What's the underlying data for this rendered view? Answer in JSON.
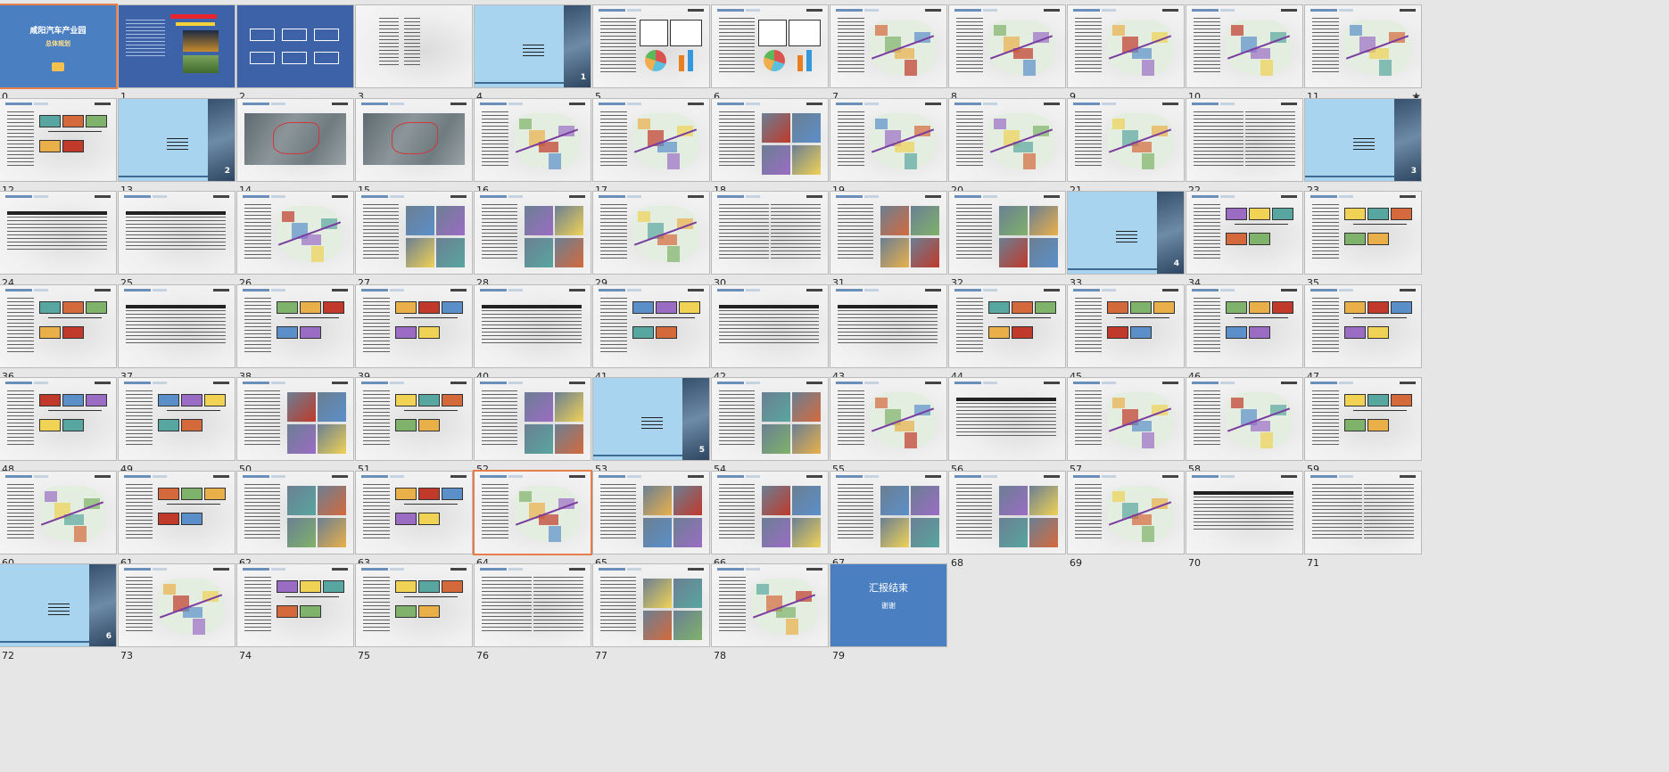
{
  "slides": [
    {
      "num": "0",
      "type": "title",
      "title": "咸阳汽车产业园",
      "subtitle": "总体规划",
      "selected": true
    },
    {
      "num": "1",
      "type": "title-banner",
      "title": ""
    },
    {
      "num": "2",
      "type": "flowchart"
    },
    {
      "num": "3",
      "type": "toc"
    },
    {
      "num": "4",
      "type": "section",
      "label": "1"
    },
    {
      "num": "5",
      "type": "content",
      "variant": "charts"
    },
    {
      "num": "6",
      "type": "content",
      "variant": "charts"
    },
    {
      "num": "7",
      "type": "content",
      "variant": "maps"
    },
    {
      "num": "8",
      "type": "content",
      "variant": "maps"
    },
    {
      "num": "9",
      "type": "content",
      "variant": "maps"
    },
    {
      "num": "10",
      "type": "content",
      "variant": "maps"
    },
    {
      "num": "11",
      "type": "content",
      "variant": "maps",
      "starred": true
    },
    {
      "num": "12",
      "type": "content",
      "variant": "diagram"
    },
    {
      "num": "13",
      "type": "section",
      "label": "2"
    },
    {
      "num": "14",
      "type": "content",
      "variant": "satellite"
    },
    {
      "num": "15",
      "type": "content",
      "variant": "satellite"
    },
    {
      "num": "16",
      "type": "content",
      "variant": "plan"
    },
    {
      "num": "17",
      "type": "content",
      "variant": "plan"
    },
    {
      "num": "18",
      "type": "content",
      "variant": "photos"
    },
    {
      "num": "19",
      "type": "content",
      "variant": "plan"
    },
    {
      "num": "20",
      "type": "content",
      "variant": "plan"
    },
    {
      "num": "21",
      "type": "content",
      "variant": "plan"
    },
    {
      "num": "22",
      "type": "content",
      "variant": "text"
    },
    {
      "num": "23",
      "type": "section",
      "label": "3"
    },
    {
      "num": "24",
      "type": "content",
      "variant": "table"
    },
    {
      "num": "25",
      "type": "content",
      "variant": "table"
    },
    {
      "num": "26",
      "type": "content",
      "variant": "plan"
    },
    {
      "num": "27",
      "type": "content",
      "variant": "photos"
    },
    {
      "num": "28",
      "type": "content",
      "variant": "photos"
    },
    {
      "num": "29",
      "type": "content",
      "variant": "plan"
    },
    {
      "num": "30",
      "type": "content",
      "variant": "text"
    },
    {
      "num": "31",
      "type": "content",
      "variant": "photos"
    },
    {
      "num": "32",
      "type": "content",
      "variant": "photos"
    },
    {
      "num": "33",
      "type": "section",
      "label": "4"
    },
    {
      "num": "34",
      "type": "content",
      "variant": "diagram"
    },
    {
      "num": "35",
      "type": "content",
      "variant": "diagram"
    },
    {
      "num": "36",
      "type": "content",
      "variant": "diagram"
    },
    {
      "num": "37",
      "type": "content",
      "variant": "table"
    },
    {
      "num": "38",
      "type": "content",
      "variant": "diagram"
    },
    {
      "num": "39",
      "type": "content",
      "variant": "diagram"
    },
    {
      "num": "40",
      "type": "content",
      "variant": "table"
    },
    {
      "num": "41",
      "type": "content",
      "variant": "diagram"
    },
    {
      "num": "42",
      "type": "content",
      "variant": "table"
    },
    {
      "num": "43",
      "type": "content",
      "variant": "table"
    },
    {
      "num": "44",
      "type": "content",
      "variant": "diagram"
    },
    {
      "num": "45",
      "type": "content",
      "variant": "diagram"
    },
    {
      "num": "46",
      "type": "content",
      "variant": "diagram"
    },
    {
      "num": "47",
      "type": "content",
      "variant": "diagram"
    },
    {
      "num": "48",
      "type": "content",
      "variant": "diagram"
    },
    {
      "num": "49",
      "type": "content",
      "variant": "diagram"
    },
    {
      "num": "50",
      "type": "content",
      "variant": "photos"
    },
    {
      "num": "51",
      "type": "content",
      "variant": "diagram"
    },
    {
      "num": "52",
      "type": "content",
      "variant": "photos"
    },
    {
      "num": "53",
      "type": "section",
      "label": "5"
    },
    {
      "num": "54",
      "type": "content",
      "variant": "photos"
    },
    {
      "num": "55",
      "type": "content",
      "variant": "plan"
    },
    {
      "num": "56",
      "type": "content",
      "variant": "table"
    },
    {
      "num": "57",
      "type": "content",
      "variant": "plan"
    },
    {
      "num": "58",
      "type": "content",
      "variant": "plan"
    },
    {
      "num": "59",
      "type": "content",
      "variant": "diagram"
    },
    {
      "num": "60",
      "type": "content",
      "variant": "plan"
    },
    {
      "num": "61",
      "type": "content",
      "variant": "diagram"
    },
    {
      "num": "62",
      "type": "content",
      "variant": "photos"
    },
    {
      "num": "63",
      "type": "content",
      "variant": "diagram"
    },
    {
      "num": "64",
      "type": "content",
      "variant": "plan",
      "highlight": true
    },
    {
      "num": "65",
      "type": "content",
      "variant": "photos"
    },
    {
      "num": "66",
      "type": "content",
      "variant": "photos"
    },
    {
      "num": "67",
      "type": "content",
      "variant": "photos"
    },
    {
      "num": "68",
      "type": "content",
      "variant": "photos"
    },
    {
      "num": "69",
      "type": "content",
      "variant": "plan"
    },
    {
      "num": "70",
      "type": "content",
      "variant": "table"
    },
    {
      "num": "71",
      "type": "content",
      "variant": "text"
    },
    {
      "num": "72",
      "type": "section",
      "label": "6"
    },
    {
      "num": "73",
      "type": "content",
      "variant": "plan"
    },
    {
      "num": "74",
      "type": "content",
      "variant": "diagram"
    },
    {
      "num": "75",
      "type": "content",
      "variant": "diagram"
    },
    {
      "num": "76",
      "type": "content",
      "variant": "text"
    },
    {
      "num": "77",
      "type": "content",
      "variant": "photos"
    },
    {
      "num": "78",
      "type": "content",
      "variant": "plan"
    },
    {
      "num": "79",
      "type": "end",
      "title": "汇报结束",
      "subtitle": "谢谢"
    }
  ],
  "colors": {
    "background": "#e6e6e6",
    "selection": "#e77d4b",
    "title_blue": "#4a7fc1",
    "section_blue": "#a8d4ef"
  }
}
